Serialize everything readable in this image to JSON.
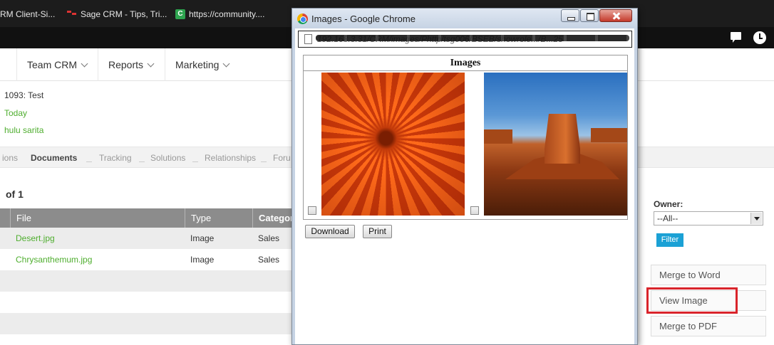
{
  "bookmarks": [
    {
      "label": "RM Client-Si...",
      "icon": "none"
    },
    {
      "label": "Sage CRM - Tips, Tri...",
      "icon": "sage-bookmark-icon"
    },
    {
      "label": "https://community....",
      "icon": "community-bookmark-icon"
    }
  ],
  "topnav": {
    "items": [
      {
        "label": "Team CRM"
      },
      {
        "label": "Reports"
      },
      {
        "label": "Marketing"
      }
    ]
  },
  "context": {
    "line1": "1093: Test",
    "line2": "Today",
    "line3": "hulu sarita"
  },
  "tabs": [
    {
      "label": "ions"
    },
    {
      "label": "Documents"
    },
    {
      "label": "Tracking"
    },
    {
      "label": "Solutions"
    },
    {
      "label": "Relationships"
    },
    {
      "label": "Foru"
    }
  ],
  "pager": "of 1",
  "grid": {
    "columns": [
      "File",
      "Type",
      "Categor"
    ],
    "rows": [
      {
        "file": "Desert.jpg",
        "type": "Image",
        "category": "Sales"
      },
      {
        "file": "Chrysanthemum.jpg",
        "type": "Image",
        "category": "Sales"
      }
    ]
  },
  "filter": {
    "owner_label": "Owner:",
    "owner_value": "--All--",
    "filter_button": "Filter"
  },
  "actions": {
    "merge_to_word": "Merge to Word",
    "view_image": "View Image",
    "merge_to_pdf": "Merge to PDF"
  },
  "popup": {
    "title": "Images - Google Chrome",
    "url": "192.168.3.31/CRM/images/Phttp/tsg006/BSEB/showrole.../B...25",
    "header": "Images",
    "download_button": "Download",
    "print_button": "Print"
  },
  "colors": {
    "accent_green": "#4fae2f",
    "filter_blue": "#1ba1d5",
    "highlight_red": "#d9242b",
    "header_black": "#111111"
  }
}
